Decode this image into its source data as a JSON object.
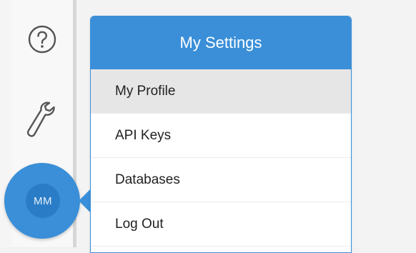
{
  "avatar": {
    "initials": "MM"
  },
  "sidebar": {
    "icons": [
      {
        "name": "help-icon"
      },
      {
        "name": "wrench-icon"
      }
    ]
  },
  "menu": {
    "title": "My Settings",
    "items": [
      {
        "label": "My Profile",
        "active": true
      },
      {
        "label": "API Keys",
        "active": false
      },
      {
        "label": "Databases",
        "active": false
      },
      {
        "label": "Log Out",
        "active": false
      }
    ]
  },
  "colors": {
    "accent": "#3a8fd8",
    "menu_active_bg": "#e6e6e6",
    "sidebar_bg": "#f8f8f8",
    "icon_stroke": "#555555"
  }
}
